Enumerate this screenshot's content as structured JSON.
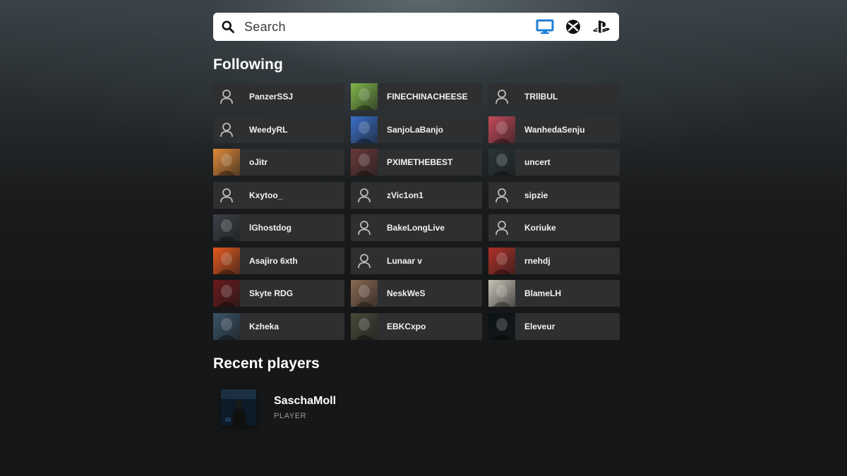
{
  "search": {
    "placeholder": "Search"
  },
  "platforms": [
    "pc-icon",
    "xbox-icon",
    "playstation-icon"
  ],
  "following": {
    "title": "Following",
    "players": [
      {
        "name": "PanzerSSJ",
        "avatar": "default",
        "color": "#2e2f31"
      },
      {
        "name": "FINECHINACHEESE",
        "avatar": "image",
        "color": "#7fb64a"
      },
      {
        "name": "TRllBUL",
        "avatar": "default",
        "color": "#2e2f31"
      },
      {
        "name": "WeedyRL",
        "avatar": "default",
        "color": "#2e2f31"
      },
      {
        "name": "SanjoLaBanjo",
        "avatar": "image",
        "color": "#3a6fc9"
      },
      {
        "name": "WanhedaSenju",
        "avatar": "image",
        "color": "#c44a5a"
      },
      {
        "name": "oJitr",
        "avatar": "image",
        "color": "#e08a3a"
      },
      {
        "name": "PXIMETHEBEST",
        "avatar": "image",
        "color": "#6a3a3a"
      },
      {
        "name": "uncert",
        "avatar": "image",
        "color": "#2a3638"
      },
      {
        "name": "Kxytoo_",
        "avatar": "default",
        "color": "#2e2f31"
      },
      {
        "name": "zVic1on1",
        "avatar": "default",
        "color": "#2e2f31"
      },
      {
        "name": "sipzie",
        "avatar": "default",
        "color": "#2e2f31"
      },
      {
        "name": "lGhostdog",
        "avatar": "image",
        "color": "#3b4148"
      },
      {
        "name": "BakeLongLive",
        "avatar": "default",
        "color": "#2e2f31"
      },
      {
        "name": "Koriuke",
        "avatar": "default",
        "color": "#2e2f31"
      },
      {
        "name": "Asajiro 6xth",
        "avatar": "image",
        "color": "#e55a1f"
      },
      {
        "name": "Lunaar v",
        "avatar": "default",
        "color": "#2e2f31"
      },
      {
        "name": "rnehdj",
        "avatar": "image",
        "color": "#b03028"
      },
      {
        "name": "Skyte RDG",
        "avatar": "image",
        "color": "#6a1a1a"
      },
      {
        "name": "NeskWeS",
        "avatar": "image",
        "color": "#8a6a52"
      },
      {
        "name": "BlameLH",
        "avatar": "image",
        "color": "#c9c4b8"
      },
      {
        "name": "Kzheka",
        "avatar": "image",
        "color": "#3a5468"
      },
      {
        "name": "EBKCxpo",
        "avatar": "image",
        "color": "#4a4a3a"
      },
      {
        "name": "Eleveur",
        "avatar": "image",
        "color": "#0a1216"
      }
    ]
  },
  "recent": {
    "title": "Recent players",
    "players": [
      {
        "name": "SaschaMoll",
        "role": "PLAYER"
      }
    ]
  }
}
